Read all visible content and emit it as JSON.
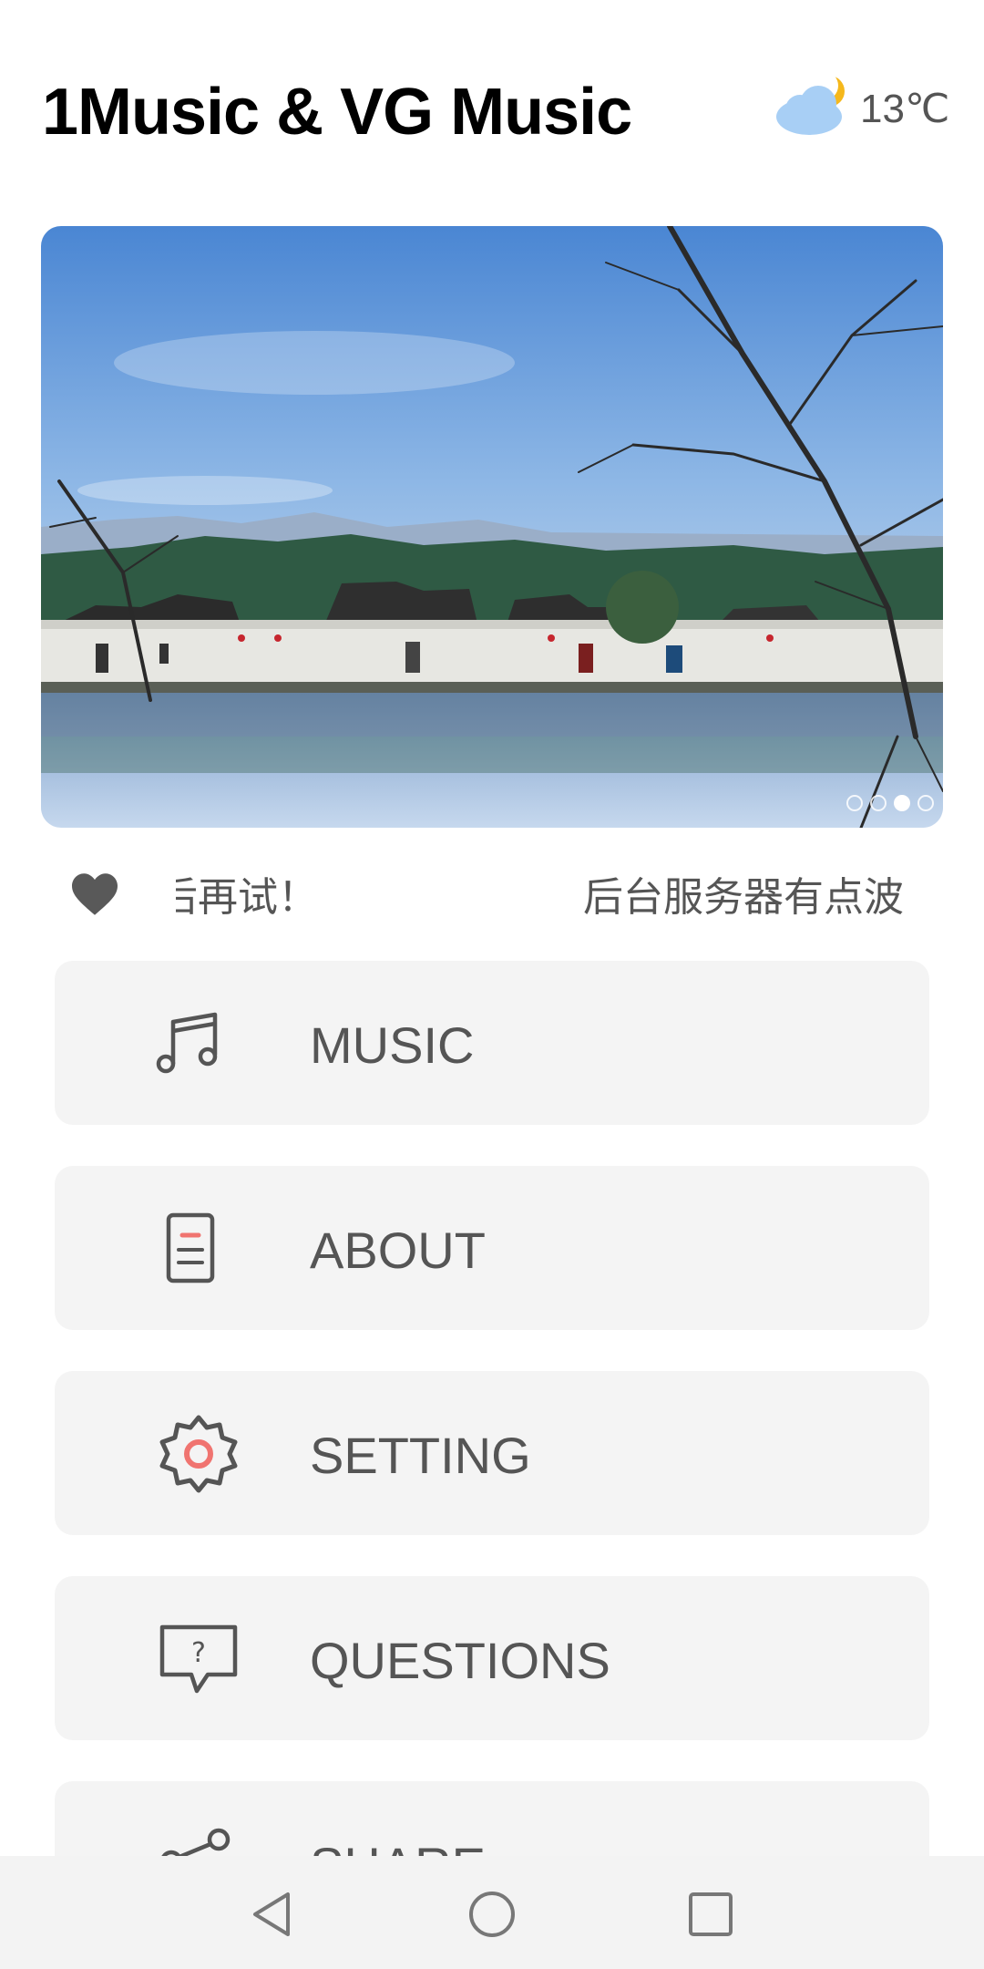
{
  "header": {
    "title": "1Music & VG Music"
  },
  "weather": {
    "icon": "partly-cloudy-icon",
    "temperature": "13℃"
  },
  "banner": {
    "image": "landscape-village-lake-photo",
    "pages": 4,
    "active_page": 3
  },
  "marquee": {
    "icon": "heart-icon",
    "text_left": "后再试！",
    "text_right": "后台服务器有点波"
  },
  "menu": [
    {
      "label": "MUSIC",
      "icon": "music-note-icon"
    },
    {
      "label": "ABOUT",
      "icon": "document-icon"
    },
    {
      "label": "SETTING",
      "icon": "gear-icon"
    },
    {
      "label": "QUESTIONS",
      "icon": "question-bubble-icon"
    },
    {
      "label": "SHARE",
      "icon": "share-icon"
    }
  ],
  "navbar": {
    "back": "back-icon",
    "home": "home-icon",
    "recents": "recents-icon"
  },
  "colors": {
    "accent": "#f07470",
    "icon_gray": "#555555",
    "card_bg": "#f4f4f4"
  }
}
